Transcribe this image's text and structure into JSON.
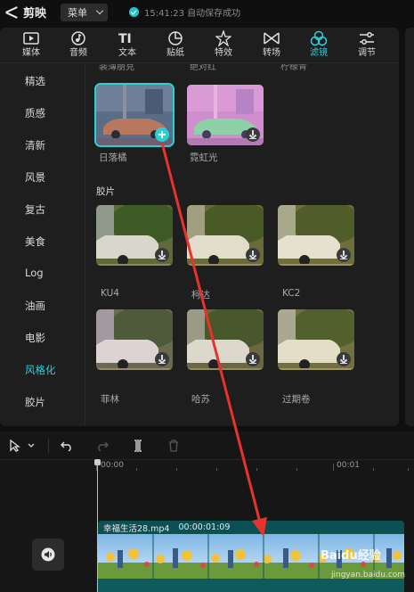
{
  "app": {
    "name": "剪映",
    "menu_label": "菜单",
    "save_status": "15:41:23 自动保存成功"
  },
  "toolbar": {
    "tabs": [
      {
        "label": "媒体",
        "icon": "media-icon"
      },
      {
        "label": "音频",
        "icon": "audio-icon"
      },
      {
        "label": "文本",
        "icon": "text-icon"
      },
      {
        "label": "贴纸",
        "icon": "sticker-icon"
      },
      {
        "label": "特效",
        "icon": "effects-icon"
      },
      {
        "label": "转场",
        "icon": "transition-icon"
      },
      {
        "label": "滤镜",
        "icon": "filter-icon",
        "active": true
      },
      {
        "label": "调节",
        "icon": "adjust-icon"
      }
    ]
  },
  "sidebar": {
    "items": [
      {
        "label": "精选"
      },
      {
        "label": "质感"
      },
      {
        "label": "清新"
      },
      {
        "label": "风景"
      },
      {
        "label": "复古"
      },
      {
        "label": "美食"
      },
      {
        "label": "Log"
      },
      {
        "label": "油画"
      },
      {
        "label": "电影"
      },
      {
        "label": "风格化",
        "active": true
      },
      {
        "label": "胶片"
      }
    ]
  },
  "filters": {
    "cut_labels": [
      "裴薄朋克",
      "绝对红",
      "柠檬青"
    ],
    "style_row": [
      {
        "label": "日落橘",
        "selected": true
      },
      {
        "label": "霓虹光"
      }
    ],
    "film_section_title": "胶片",
    "film_row1": [
      {
        "label": "KU4"
      },
      {
        "label": "柯达"
      },
      {
        "label": "KC2"
      }
    ],
    "film_row2": [
      {
        "label": "菲林"
      },
      {
        "label": "哈苏"
      },
      {
        "label": "过期卷"
      }
    ]
  },
  "timeline": {
    "ruler_start": "00:00",
    "ruler_end": "00:01",
    "clip_name": "幸福生活28.mp4",
    "clip_duration": "00:00:01:09"
  },
  "watermark": {
    "text": "Baidu经验",
    "sub": "jingyan.baidu.com"
  },
  "colors": {
    "accent": "#2ad0d8",
    "annotation_arrow": "#e8322e",
    "clip": "#0f5a5d"
  }
}
